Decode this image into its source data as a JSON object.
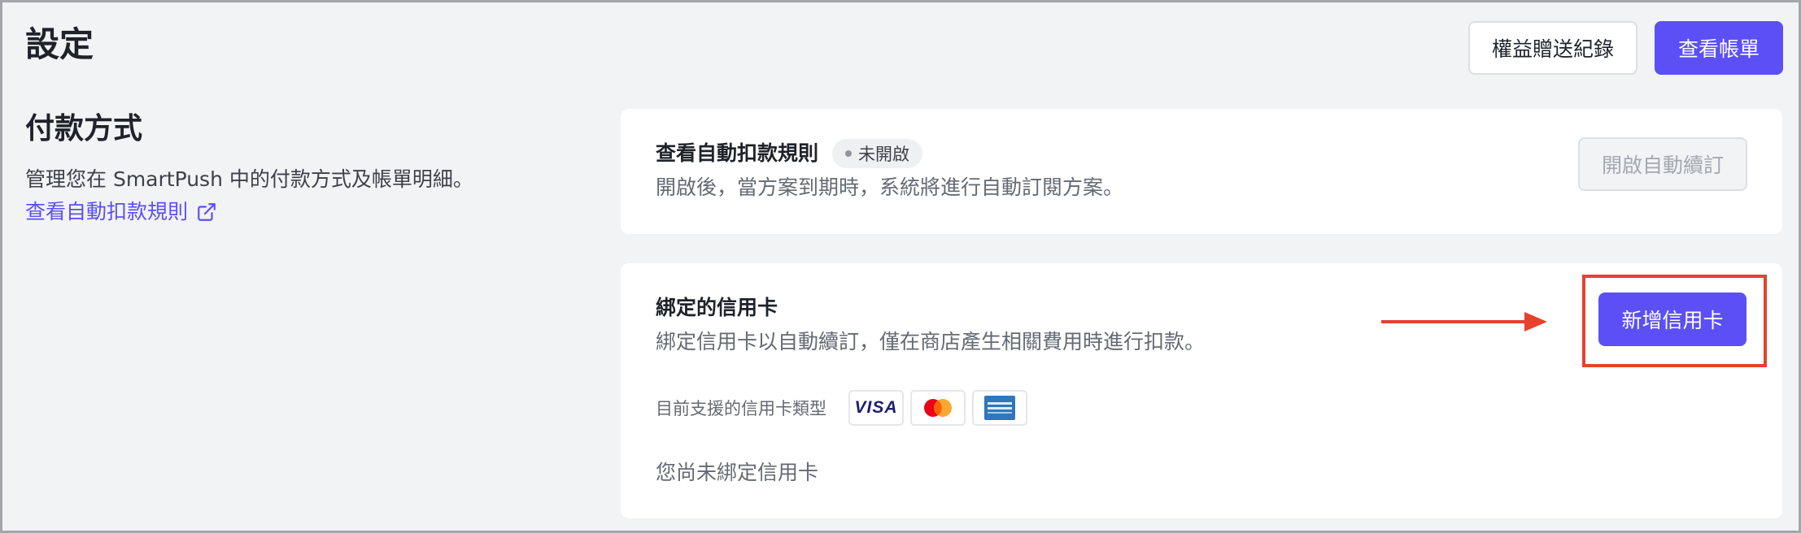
{
  "header": {
    "title": "設定",
    "gift_records_label": "權益贈送紀錄",
    "view_bill_label": "查看帳單"
  },
  "payment_section": {
    "title": "付款方式",
    "description": "管理您在 SmartPush 中的付款方式及帳單明細。",
    "rules_link_label": "查看自動扣款規則"
  },
  "auto_renew_card": {
    "title": "查看自動扣款規則",
    "status_badge": "未開啟",
    "description": "開啟後，當方案到期時，系統將進行自動訂閱方案。",
    "enable_button_label": "開啟自動續訂"
  },
  "credit_card_section": {
    "title": "綁定的信用卡",
    "description": "綁定信用卡以自動續訂，僅在商店產生相關費用時進行扣款。",
    "add_card_button_label": "新增信用卡",
    "supported_types_label": "目前支援的信用卡類型",
    "card_types": [
      {
        "name": "visa",
        "text": "VISA",
        "color": "#1a1f71"
      },
      {
        "name": "mastercard",
        "colors": [
          "#eb001b",
          "#f79e1b"
        ]
      },
      {
        "name": "amex",
        "text": "AMERICAN EXPRESS",
        "color": "#2e77bc"
      }
    ],
    "empty_state": "您尚未綁定信用卡"
  },
  "colors": {
    "primary": "#5b4ff5",
    "annotation": "#e8412d",
    "background": "#f2f3f5"
  }
}
